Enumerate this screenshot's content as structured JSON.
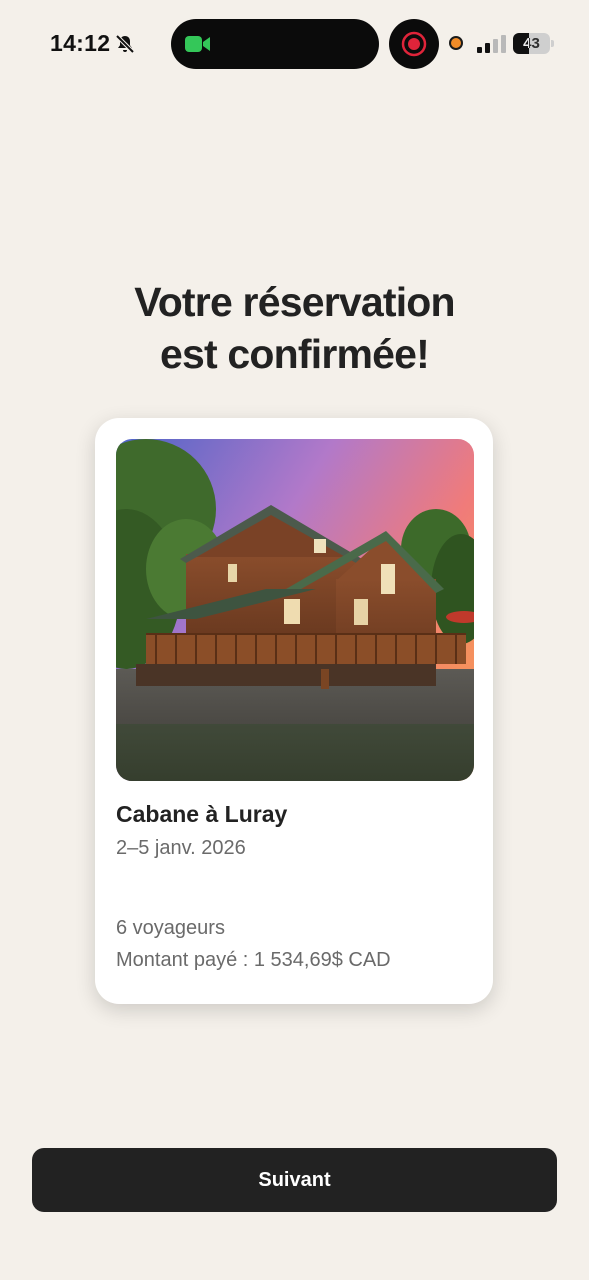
{
  "status_bar": {
    "time": "14:12",
    "battery_level": "43",
    "battery_fraction": 0.43,
    "icons": [
      "bell-slash-icon",
      "facetime-video-icon",
      "screen-record-icon",
      "mic-indicator-dot",
      "cellular-signal-icon",
      "battery-icon"
    ]
  },
  "confirmation": {
    "heading_line1": "Votre réservation",
    "heading_line2": "est confirmée!"
  },
  "listing": {
    "title": "Cabane à Luray",
    "dates": "2–5 janv. 2026",
    "guests": "6 voyageurs",
    "amount_paid": "Montant payé : 1 534,69$ CAD"
  },
  "actions": {
    "next_label": "Suivant"
  },
  "colors": {
    "background": "#f4f0ea",
    "card": "#ffffff",
    "button": "#222222",
    "text_primary": "#222222",
    "text_secondary": "#6a6a6a",
    "facetime_green": "#34c759",
    "record_red": "#e0243a",
    "mic_orange": "#f28c28"
  }
}
